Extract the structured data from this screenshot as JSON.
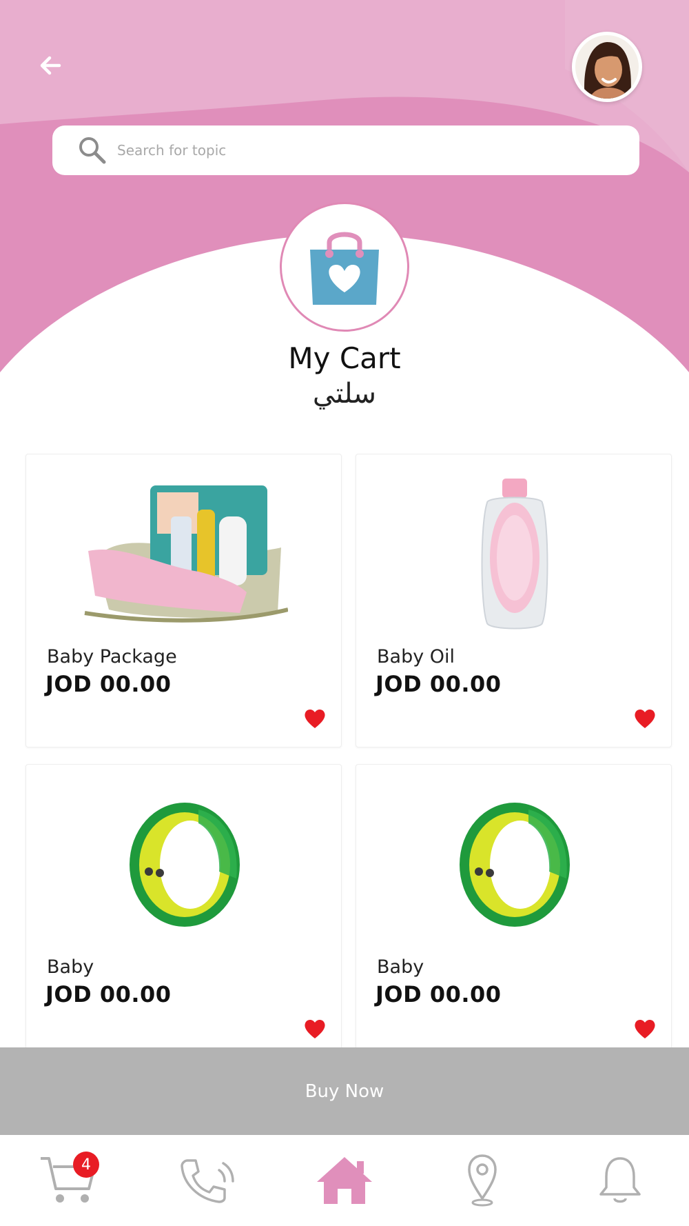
{
  "header": {
    "back_icon": "arrow-left-icon",
    "avatar_icon": "user-avatar",
    "colors": {
      "pink_light": "#e8aece",
      "pink_dark": "#e08fbb",
      "bag_blue": "#5ba7c9"
    }
  },
  "search": {
    "placeholder": "Search for topic",
    "icon": "search-icon"
  },
  "page": {
    "title_en": "My Cart",
    "title_ar": "سلتي",
    "icon": "shopping-bag-heart-icon"
  },
  "products": [
    {
      "name": "Baby Package",
      "price": "JOD 00.00",
      "image": "baby-basket-image",
      "favorite": true
    },
    {
      "name": "Baby Oil",
      "price": "JOD 00.00",
      "image": "baby-oil-bottle-image",
      "favorite": true
    },
    {
      "name": "Baby",
      "price": "JOD 00.00",
      "image": "green-bracelet-image",
      "favorite": true
    },
    {
      "name": "Baby",
      "price": "JOD 00.00",
      "image": "green-bracelet-image",
      "favorite": true
    }
  ],
  "buy_now": {
    "label": "Buy Now"
  },
  "tabbar": {
    "cart_count": "4",
    "items": [
      "cart-icon",
      "phone-icon",
      "home-icon",
      "location-icon",
      "bell-icon"
    ]
  }
}
